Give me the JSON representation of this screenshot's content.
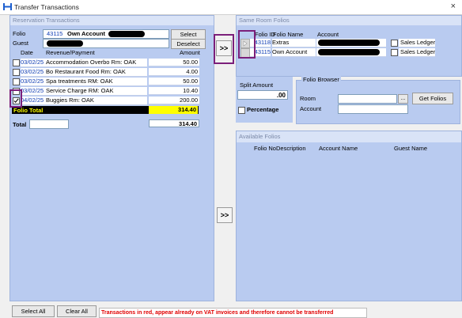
{
  "window": {
    "title": "Transfer Transactions",
    "close": "×"
  },
  "left": {
    "header": "Reservation Transactions",
    "folio_label": "Folio",
    "folio_no": "43115",
    "folio_name": "Own Account",
    "guest_label": "Guest",
    "select": "Select",
    "deselect": "Deselect",
    "cols": {
      "date": "Date",
      "rev": "Revenue/Payment",
      "amount": "Amount"
    },
    "rows": [
      {
        "date": "03/02/25",
        "desc": "Accommodation Overbo Rm: OAK",
        "amount": "50.00",
        "checked": false
      },
      {
        "date": "03/02/25",
        "desc": "Bo Restaurant Food Rm: OAK",
        "amount": "4.00",
        "checked": false
      },
      {
        "date": "03/02/25",
        "desc": "Spa treatments RM: OAK",
        "amount": "50.00",
        "checked": false
      },
      {
        "date": "03/02/25",
        "desc": "Service Charge RM: OAK",
        "amount": "10.40",
        "checked": false
      },
      {
        "date": "04/02/25",
        "desc": "Buggies Rm: OAK",
        "amount": "200.00",
        "checked": true
      }
    ],
    "folio_total_label": "Folio Total",
    "folio_total": "314.40",
    "total_label": "Total",
    "total": "314.40"
  },
  "transfer_btn": ">>",
  "transfer_btn2": ">>",
  "same_room": {
    "header": "Same Room Folios",
    "cols": {
      "id": "Folio ID",
      "name": "Folio Name",
      "account": "Account"
    },
    "rows": [
      {
        "id": "43118",
        "name": "Extras",
        "sales": "Sales Ledger"
      },
      {
        "id": "43115",
        "name": "Own Account",
        "sales": "Sales Ledger"
      }
    ]
  },
  "split": {
    "label": "Split Amount",
    "value": ".00",
    "percentage": "Percentage"
  },
  "browser": {
    "label": "Folio Browser",
    "room": "Room",
    "account": "Account",
    "ellipsis": "...",
    "get": "Get Folios"
  },
  "available": {
    "header": "Available Folios",
    "cols": {
      "folio": "Folio No",
      "desc": "Description",
      "account": "Account Name",
      "guest": "Guest Name"
    }
  },
  "footer": {
    "select_all": "Select All",
    "clear_all": "Clear All",
    "warning": "Transactions in red, appear already on VAT invoices and therefore cannot be transferred"
  },
  "colors": {
    "panel": "#b9cbf0",
    "highlight_total": "#ffff00",
    "warning": "#e00000",
    "annotation": "#7b1f7a"
  }
}
